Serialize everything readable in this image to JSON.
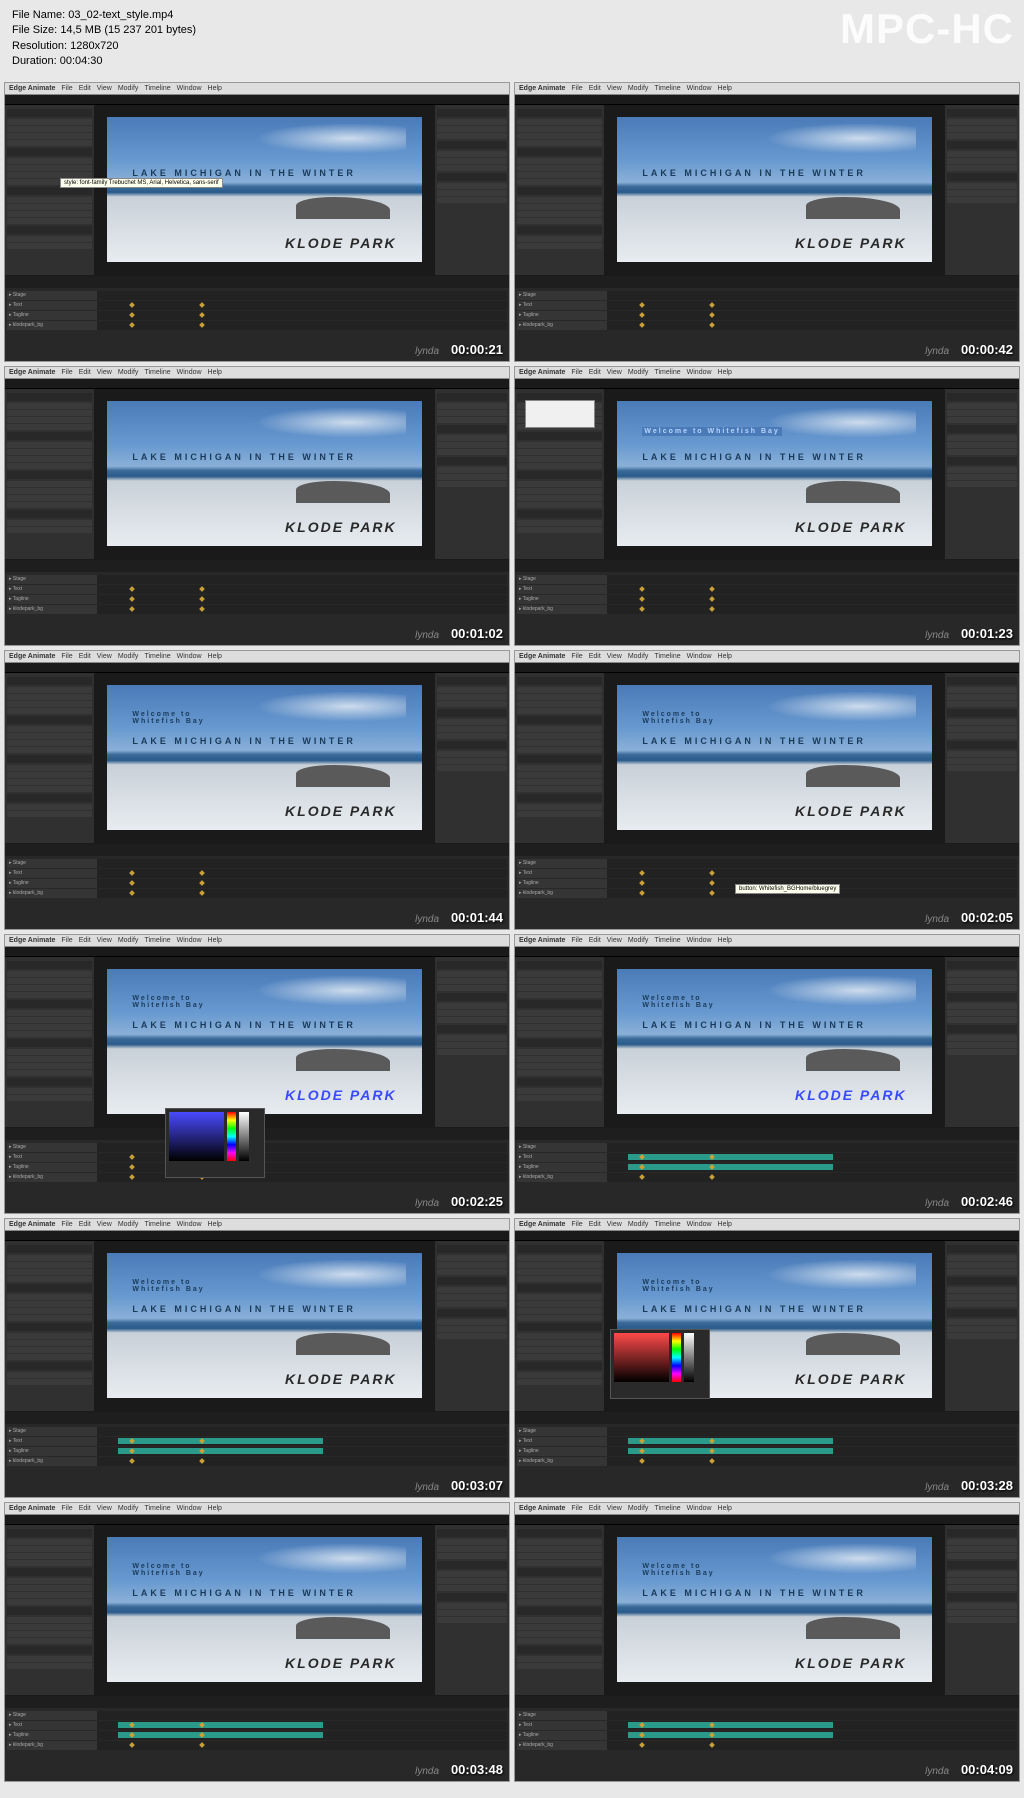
{
  "file_info": {
    "name_label": "File Name:",
    "name": "03_02-text_style.mp4",
    "size_label": "File Size:",
    "size": "14,5 MB (15 237 201 bytes)",
    "resolution_label": "Resolution:",
    "resolution": "1280x720",
    "duration_label": "Duration:",
    "duration": "00:04:30"
  },
  "watermark": "MPC-HC",
  "app": {
    "title": "Edge Animate",
    "menu": [
      "File",
      "Edit",
      "View",
      "Modify",
      "Timeline",
      "Window",
      "Help"
    ],
    "scene_main": "LAKE MICHIGAN IN THE WINTER",
    "scene_park": "KLODE PARK",
    "welcome": "Welcome to Whitefish Bay",
    "welcome_short1": "Welcome to",
    "welcome_short2": "Whitefish Bay",
    "lynda": "lynda"
  },
  "thumbs": [
    {
      "ts": "00:00:21",
      "welcome": false,
      "park_blue": false,
      "tooltip": true,
      "clips": false
    },
    {
      "ts": "00:00:42",
      "welcome": false,
      "park_blue": false,
      "clips": false
    },
    {
      "ts": "00:01:02",
      "welcome": false,
      "park_blue": false,
      "clips": false
    },
    {
      "ts": "00:01:23",
      "welcome": "hl",
      "park_blue": false,
      "dialog": true,
      "clips": false
    },
    {
      "ts": "00:01:44",
      "welcome": true,
      "park_blue": false,
      "clips": false
    },
    {
      "ts": "00:02:05",
      "welcome": true,
      "park_blue": false,
      "tooltip2": true,
      "clips": false
    },
    {
      "ts": "00:02:25",
      "welcome": true,
      "park_blue": true,
      "picker": "blue",
      "clips": false
    },
    {
      "ts": "00:02:46",
      "welcome": true,
      "park_blue": true,
      "clips": true
    },
    {
      "ts": "00:03:07",
      "welcome": true,
      "park_blue": false,
      "clips": true
    },
    {
      "ts": "00:03:28",
      "welcome": true,
      "park_blue": false,
      "picker": "red",
      "clips": true
    },
    {
      "ts": "00:03:48",
      "welcome": true,
      "park_blue": false,
      "clips": true
    },
    {
      "ts": "00:04:09",
      "welcome": true,
      "park_blue": false,
      "clips": true
    }
  ]
}
